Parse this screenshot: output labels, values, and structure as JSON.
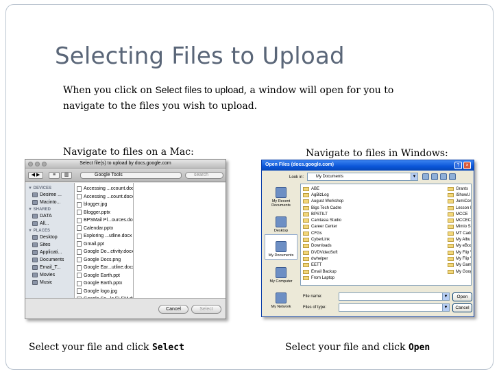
{
  "slide": {
    "title": "Selecting Files to Upload",
    "intro_pre": "When you click on ",
    "intro_em": "Select files to upload",
    "intro_post": ", a window will open for you to navigate to the files you wish to upload.",
    "mac_caption": "Navigate to files on a Mac:",
    "win_caption": "Navigate to files in Windows:",
    "mac_footer_pre": "Select your file and click ",
    "mac_footer_btn": "Select",
    "win_footer_pre": "Select your file and click ",
    "win_footer_btn": "Open"
  },
  "mac": {
    "title": "Select file(s) to upload by docs.google.com",
    "back_fwd": "◀ ▶",
    "folder": "Google Tools",
    "search_placeholder": "search",
    "sections": [
      {
        "label": "▼ DEVICES",
        "items": [
          "Desiree ...",
          "Macinto..."
        ]
      },
      {
        "label": "▼ SHARED",
        "items": [
          "DATA",
          "All..."
        ]
      },
      {
        "label": "▼ PLACES",
        "items": [
          "Desktop",
          "Sites",
          "Applicati...",
          "Documents",
          "Email_T...",
          "Movies",
          "Music"
        ]
      }
    ],
    "files": [
      "Accessing ...ccount.doc",
      "Accessing ...count.docx",
      "blogger.jpg",
      "Blogger.pptx",
      "BPSMail Pl...ources.doc",
      "Calendar.pptx",
      "Exploring ...utline.docx",
      "Gmail.ppt",
      "Google Do...ctivity.docx",
      "Google Docs.png",
      "Google Ear...utline.docx",
      "Google Earth.ppt",
      "Google Earth.pptx",
      "Google logo.jpg",
      "Google Se...ls ELEM.doc"
    ],
    "cancel_label": "Cancel",
    "select_label": "Select"
  },
  "win": {
    "title": "Open Files (docs.google.com)",
    "help": "?",
    "close": "×",
    "look_in_label": "Look in:",
    "look_in_value": "My Documents",
    "places": [
      "My Recent Documents",
      "Desktop",
      "My Documents",
      "My Computer",
      "My Network"
    ],
    "files_col1": [
      "ABE",
      "AgBizLog",
      "August Workshop",
      "Bigs Tech Cadre",
      "BPSTILT",
      "Camtasia Studio",
      "Career Center",
      "CFGs",
      "CyberLink",
      "Downloads",
      "DVDVideoSoft",
      "dwhelper",
      "EETT",
      "Email Backup",
      "From Laptop"
    ],
    "files_col2": [
      "Grants",
      "iShowU",
      "JumiCen",
      "Lesson I",
      "MCCE",
      "MCCEC",
      "Mimio St",
      "MT Cadr",
      "My Albu",
      "My eBoo",
      "My Flip V",
      "My Flip V",
      "My Gam",
      "My Goog"
    ],
    "file_name_label": "File name:",
    "file_type_label": "Files of type:",
    "open_label": "Open",
    "cancel_label": "Cancel"
  }
}
